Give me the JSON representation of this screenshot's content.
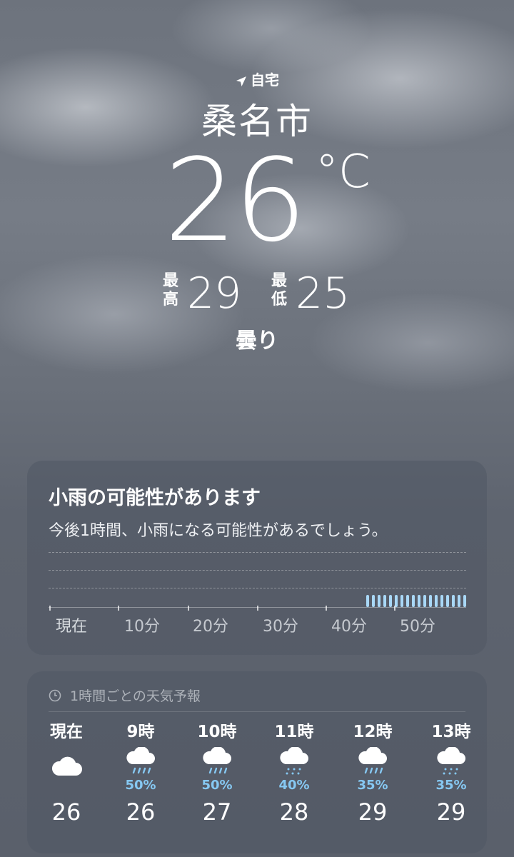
{
  "header": {
    "location_label": "自宅",
    "city": "桑名市",
    "temperature": "26",
    "unit": "°C",
    "high_label": "最高",
    "high": "29",
    "low_label": "最低",
    "low": "25",
    "condition": "曇り"
  },
  "precip_card": {
    "title": "小雨の可能性があります",
    "description": "今後1時間、小雨になる可能性があるでしょう。",
    "axis_labels": [
      "現在",
      "10分",
      "20分",
      "30分",
      "40分",
      "50分"
    ],
    "rain_start_fraction": 0.76,
    "bar_color": "#a9d8f7"
  },
  "hourly_card": {
    "header": "1時間ごとの天気予報",
    "header_icon": "clock-icon",
    "hours": [
      {
        "time": "現在",
        "icon": "cloud-icon",
        "precip": "",
        "temp": "26"
      },
      {
        "time": "9時",
        "icon": "cloud-rain-icon",
        "precip": "50%",
        "temp": "26"
      },
      {
        "time": "10時",
        "icon": "cloud-rain-icon",
        "precip": "50%",
        "temp": "27"
      },
      {
        "time": "11時",
        "icon": "cloud-drizzle-icon",
        "precip": "40%",
        "temp": "28"
      },
      {
        "time": "12時",
        "icon": "cloud-rain-icon",
        "precip": "35%",
        "temp": "29"
      },
      {
        "time": "13時",
        "icon": "cloud-drizzle-icon",
        "precip": "35%",
        "temp": "29"
      }
    ]
  }
}
